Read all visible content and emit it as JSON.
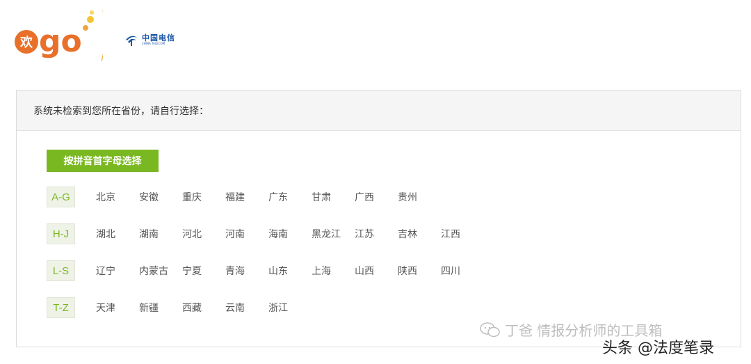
{
  "header": {
    "logo_main": "欢go",
    "telecom_cn": "中国电信",
    "telecom_en": "CHINA TELECOM"
  },
  "panel": {
    "title": "系统未检索到您所在省份，请自行选择：",
    "pinyin_button": "按拼音首字母选择",
    "groups": [
      {
        "label": "A-G",
        "provinces": [
          "北京",
          "安徽",
          "重庆",
          "福建",
          "广东",
          "甘肃",
          "广西",
          "贵州"
        ]
      },
      {
        "label": "H-J",
        "provinces": [
          "湖北",
          "湖南",
          "河北",
          "河南",
          "海南",
          "黑龙江",
          "江苏",
          "吉林",
          "江西"
        ]
      },
      {
        "label": "L-S",
        "provinces": [
          "辽宁",
          "内蒙古",
          "宁夏",
          "青海",
          "山东",
          "上海",
          "山西",
          "陕西",
          "四川"
        ]
      },
      {
        "label": "T-Z",
        "provinces": [
          "天津",
          "新疆",
          "西藏",
          "云南",
          "浙江"
        ]
      }
    ]
  },
  "watermarks": {
    "wechat": "丁爸 情报分析师的工具箱",
    "toutiao": "头条 @法度笔录"
  },
  "colors": {
    "accent_green": "#7ab821",
    "logo_orange": "#e8702a",
    "telecom_blue": "#1a56a8"
  }
}
